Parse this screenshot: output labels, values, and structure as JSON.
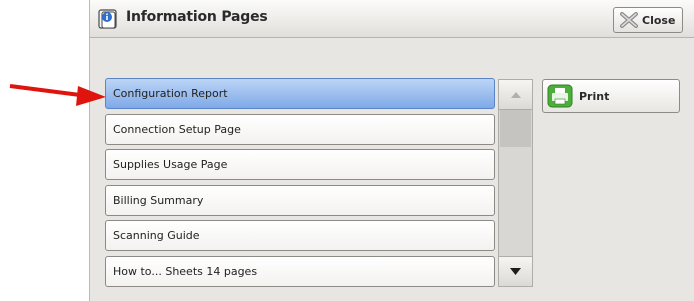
{
  "window": {
    "title": "Information Pages",
    "icon": "info-pages-icon"
  },
  "toolbar": {
    "close_label": "Close",
    "close_icon": "close-x-icon"
  },
  "list": {
    "items": [
      {
        "label": "Configuration Report",
        "selected": true
      },
      {
        "label": "Connection Setup Page",
        "selected": false
      },
      {
        "label": "Supplies Usage Page",
        "selected": false
      },
      {
        "label": "Billing Summary",
        "selected": false
      },
      {
        "label": "Scanning Guide",
        "selected": false
      },
      {
        "label": "How to... Sheets 14 pages",
        "selected": false
      }
    ]
  },
  "actions": {
    "print_label": "Print",
    "print_icon": "printer-icon"
  },
  "scrollbar": {
    "up_icon": "scroll-up-icon",
    "down_icon": "scroll-down-icon"
  },
  "annotation": {
    "pointer": "red-arrow-icon",
    "color": "#e0140f"
  },
  "colors": {
    "selected": "#7fa9e8",
    "panel": "#e8e6e3"
  }
}
